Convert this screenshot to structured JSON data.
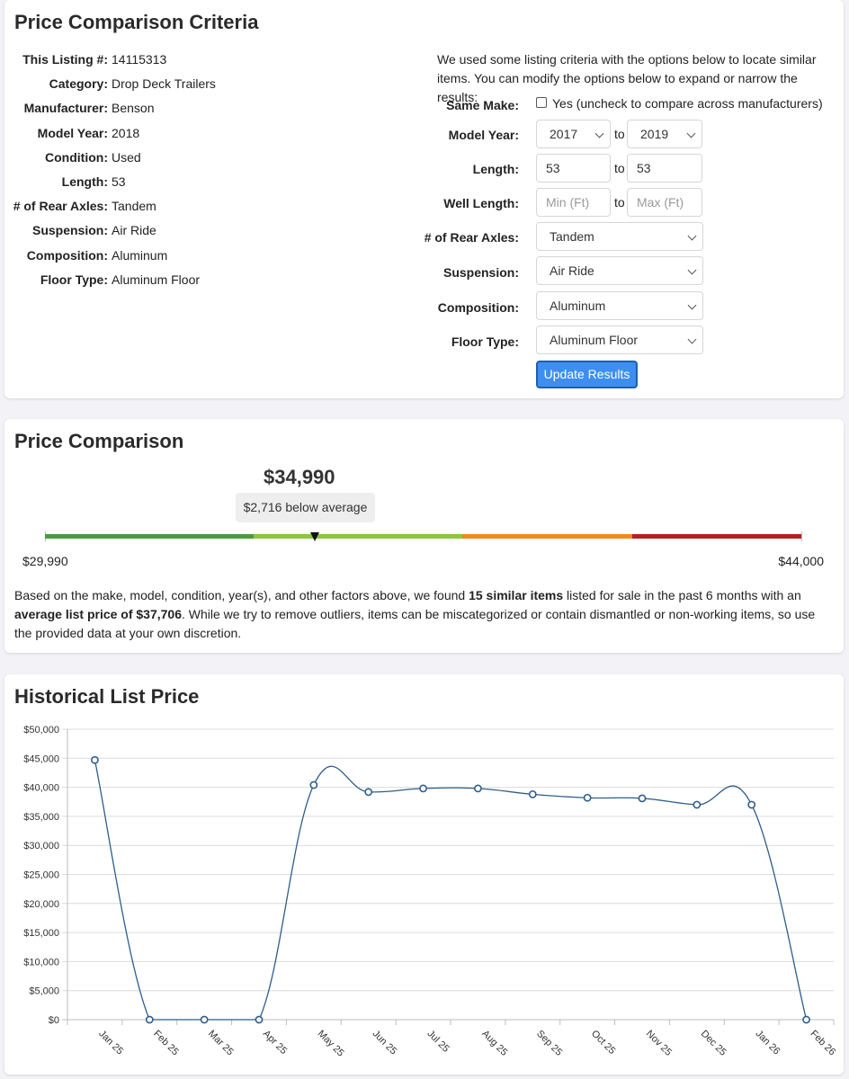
{
  "criteria": {
    "title": "Price Comparison Criteria",
    "listing": [
      {
        "label": "This Listing #:",
        "value": "14115313"
      },
      {
        "label": "Category:",
        "value": "Drop Deck Trailers"
      },
      {
        "label": "Manufacturer:",
        "value": "Benson"
      },
      {
        "label": "Model Year:",
        "value": "2018"
      },
      {
        "label": "Condition:",
        "value": "Used"
      },
      {
        "label": "Length:",
        "value": "53"
      },
      {
        "label": "# of Rear Axles:",
        "value": "Tandem"
      },
      {
        "label": "Suspension:",
        "value": "Air Ride"
      },
      {
        "label": "Composition:",
        "value": "Aluminum"
      },
      {
        "label": "Floor Type:",
        "value": "Aluminum Floor"
      }
    ],
    "intro": "We used some listing criteria with the options below to locate similar items. You can modify the options below to expand or narrow the results:",
    "same_make": {
      "label": "Same Make:",
      "checkbox_text": "Yes (uncheck to compare across manufacturers)",
      "checked": false
    },
    "model_year": {
      "label": "Model Year:",
      "from": "2017",
      "to_word": "to",
      "to": "2019"
    },
    "length": {
      "label": "Length:",
      "from": "53",
      "to_word": "to",
      "to": "53"
    },
    "well_length": {
      "label": "Well Length:",
      "min_placeholder": "Min (Ft)",
      "to_word": "to",
      "max_placeholder": "Max (Ft)"
    },
    "rear_axles": {
      "label": "# of Rear Axles:",
      "value": "Tandem"
    },
    "suspension": {
      "label": "Suspension:",
      "value": "Air Ride"
    },
    "composition": {
      "label": "Composition:",
      "value": "Aluminum"
    },
    "floor_type": {
      "label": "Floor Type:",
      "value": "Aluminum Floor"
    },
    "update_button": "Update Results"
  },
  "price_comparison": {
    "title": "Price Comparison",
    "price": "$34,990",
    "badge": "$2,716 below average",
    "range_low": "$29,990",
    "range_high": "$44,000",
    "bar_colors": [
      "#4a9d3e",
      "#8dc63f",
      "#ee8a1e",
      "#b62020"
    ],
    "desc_1": "Based on the make, model, condition, year(s), and other factors above, we found ",
    "desc_b1": "15 similar items",
    "desc_2": " listed for sale in the past 6 months with an ",
    "desc_b2": "average list price of $37,706",
    "desc_3": ". While we try to remove outliers, items can be miscategorized or contain dismantled or non-working items, so use the provided data at your own discretion."
  },
  "history": {
    "title": "Historical List Price"
  },
  "chart_data": {
    "type": "line",
    "title": "Historical List Price",
    "categories": [
      "Jan 25",
      "Feb 25",
      "Mar 25",
      "Apr 25",
      "May 25",
      "Jun 25",
      "Jul 25",
      "Aug 25",
      "Sep 25",
      "Oct 25",
      "Nov 25",
      "Dec 25",
      "Jan 26",
      "Feb 26"
    ],
    "values": [
      44700,
      0,
      0,
      0,
      40400,
      39200,
      39800,
      39800,
      38800,
      38200,
      38100,
      37000,
      37000,
      0
    ],
    "y_ticks": [
      "$0",
      "$5,000",
      "$10,000",
      "$15,000",
      "$20,000",
      "$25,000",
      "$30,000",
      "$35,000",
      "$40,000",
      "$45,000",
      "$50,000"
    ],
    "ylim": [
      0,
      50000
    ],
    "grid": true,
    "line_color": "#2f5d8a"
  }
}
